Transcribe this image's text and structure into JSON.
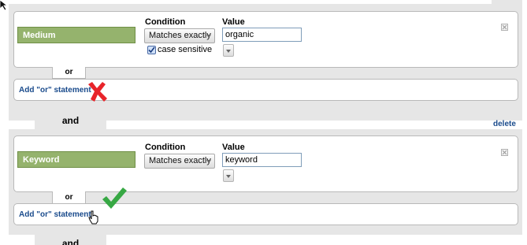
{
  "filters": [
    {
      "dimension": "Medium",
      "condition_header": "Condition",
      "value_header": "Value",
      "condition": "Matches exactly",
      "value": "organic",
      "case_sensitive_label": "case sensitive",
      "case_sensitive": true,
      "or_label": "or",
      "add_or_label": "Add \"or\" statement",
      "marker": "x-mark-red"
    },
    {
      "dimension": "Keyword",
      "condition_header": "Condition",
      "value_header": "Value",
      "condition": "Matches exactly",
      "value": "keyword",
      "or_label": "or",
      "add_or_label": "Add \"or\" statement",
      "marker": "check-mark-green"
    }
  ],
  "and_label": "and",
  "delete_label": "delete",
  "colors": {
    "dimension_bg": "#95b36d",
    "link": "#1a4b8c",
    "x_mark": "#e8242a",
    "check_mark": "#37a844",
    "panel_bg": "#e6e6e6"
  }
}
